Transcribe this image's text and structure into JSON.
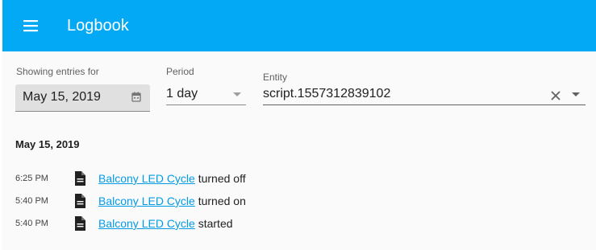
{
  "toolbar": {
    "title": "Logbook",
    "menu_icon": "hamburger-menu-icon",
    "background": "#03a9f4"
  },
  "filters": {
    "date": {
      "label": "Showing entries for",
      "value": "May 15, 2019",
      "icon": "calendar-icon"
    },
    "period": {
      "label": "Period",
      "value": "1 day",
      "icon": "caret-down-icon"
    },
    "entity": {
      "label": "Entity",
      "value": "script.1557312839102",
      "clear_icon": "close-icon",
      "dropdown_icon": "caret-down-icon"
    }
  },
  "log": {
    "day": "May 15, 2019",
    "entries": [
      {
        "time": "6:25 PM",
        "icon": "file-document-icon",
        "name": "Balcony LED Cycle",
        "message": "turned off"
      },
      {
        "time": "5:40 PM",
        "icon": "file-document-icon",
        "name": "Balcony LED Cycle",
        "message": "turned on"
      },
      {
        "time": "5:40 PM",
        "icon": "file-document-icon",
        "name": "Balcony LED Cycle",
        "message": "started"
      }
    ]
  },
  "colors": {
    "link": "#039be5",
    "date_field_bg": "#e0e0e0"
  }
}
